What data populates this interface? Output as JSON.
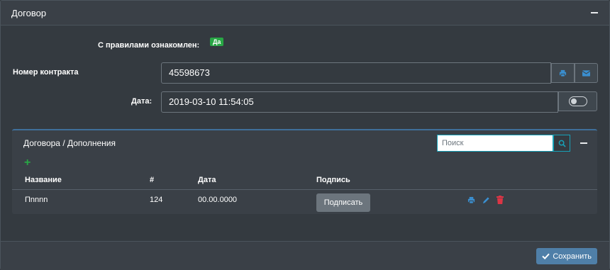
{
  "card": {
    "title": "Договор"
  },
  "form": {
    "rules_label": "С правилами ознакомлен:",
    "rules_badge": "Да",
    "contract_label": "Номер контракта",
    "contract_value": "45598673",
    "date_label": "Дата:",
    "date_value": "2019-03-10 11:54:05"
  },
  "subcard": {
    "title": "Договора / Дополнения",
    "search_placeholder": "Поиск",
    "add_glyph": "+",
    "columns": [
      "Название",
      "#",
      "Дата",
      "Подпись"
    ],
    "rows": [
      {
        "name": "Пnnnn",
        "num": "124",
        "date": "00.00.0000",
        "sign_label": "Подписать"
      }
    ]
  },
  "footer": {
    "save_label": "Сохранить"
  },
  "colors": {
    "accent": "#4f7fa8",
    "success": "#28a745",
    "danger": "#dc3545",
    "info": "#17a2b8"
  },
  "icons": [
    "print-icon",
    "mail-icon",
    "search-icon",
    "edit-icon",
    "trash-icon",
    "check-icon",
    "plus-icon",
    "minus-icon"
  ]
}
